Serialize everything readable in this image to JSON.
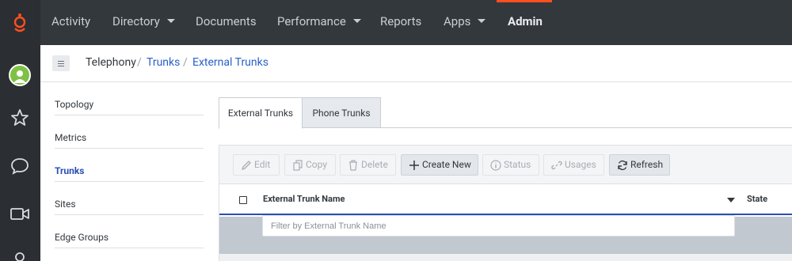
{
  "nav": {
    "items": [
      {
        "label": "Activity"
      },
      {
        "label": "Directory"
      },
      {
        "label": "Documents"
      },
      {
        "label": "Performance"
      },
      {
        "label": "Reports"
      },
      {
        "label": "Apps"
      },
      {
        "label": "Admin"
      }
    ],
    "active_color": "#ff4f1f"
  },
  "rail": {
    "icons": [
      "genesys-logo-icon",
      "user-avatar-icon",
      "star-icon",
      "chat-bubble-icon",
      "video-icon",
      "location-icon"
    ],
    "avatar_color": "#7fc144"
  },
  "breadcrumb": {
    "items": [
      {
        "label": "Telephony"
      },
      {
        "label": "Trunks"
      },
      {
        "label": "External Trunks"
      }
    ],
    "separator": "/"
  },
  "sidemenu": {
    "items": [
      {
        "label": "Topology"
      },
      {
        "label": "Metrics"
      },
      {
        "label": "Trunks"
      },
      {
        "label": "Sites"
      },
      {
        "label": "Edge Groups"
      }
    ],
    "selected": "Trunks"
  },
  "tabs": [
    {
      "label": "External Trunks"
    },
    {
      "label": "Phone Trunks"
    }
  ],
  "toolbar": {
    "edit": "Edit",
    "copy": "Copy",
    "delete": "Delete",
    "create": "Create New",
    "status": "Status",
    "usages": "Usages",
    "refresh": "Refresh"
  },
  "table": {
    "columns": [
      {
        "label": "External Trunk Name"
      },
      {
        "label": "State"
      }
    ],
    "filter_placeholder": "Filter by External Trunk Name"
  }
}
